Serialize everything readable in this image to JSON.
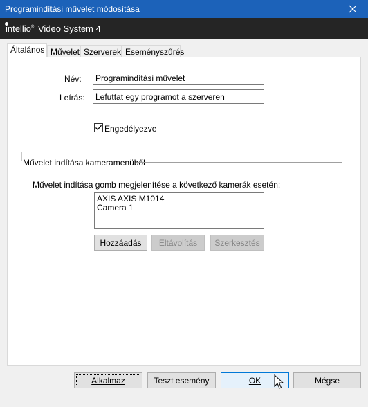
{
  "window": {
    "title": "Programindítási művelet módosítása"
  },
  "brand": {
    "name": "intellio",
    "product": "Video System 4"
  },
  "tabs": [
    {
      "label": "Általános"
    },
    {
      "label": "Művelet"
    },
    {
      "label": "Szerverek"
    },
    {
      "label": "Eseményszűrés"
    }
  ],
  "general": {
    "name_label": "Név:",
    "name_value": "Programindítási művelet",
    "desc_label": "Leírás:",
    "desc_value": "Lefuttat egy programot a szerveren",
    "enabled_label": "Engedélyezve",
    "enabled_checked": true
  },
  "camera_menu": {
    "group_title": "Művelet indítása kameramenüből",
    "list_label": "Művelet indítása gomb megjelenítése a következő kamerák esetén:",
    "cameras": [
      "AXIS AXIS M1014",
      "Camera 1"
    ],
    "add_label": "Hozzáadás",
    "remove_label": "Eltávolítás",
    "edit_label": "Szerkesztés"
  },
  "footer": {
    "apply_label": "Alkalmaz",
    "test_label": "Teszt esemény",
    "ok_label": "OK",
    "cancel_label": "Mégse"
  }
}
